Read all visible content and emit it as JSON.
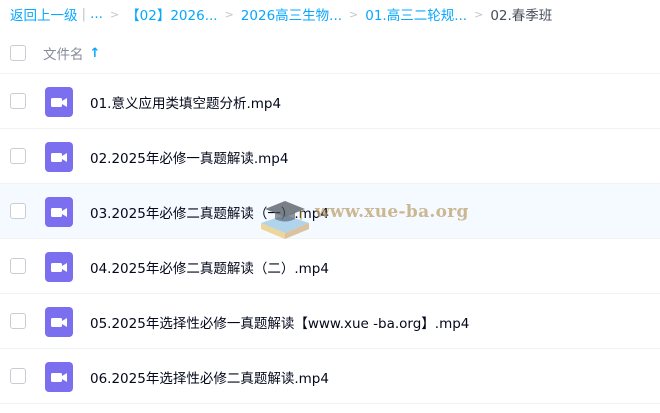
{
  "breadcrumb": {
    "back": "返回上一级",
    "ellipsis": "...",
    "items": [
      {
        "label": "【02】2026..."
      },
      {
        "label": "2026高三生物..."
      },
      {
        "label": "01.高三二轮规..."
      }
    ],
    "current": "02.春季班"
  },
  "header": {
    "name_label": "文件名",
    "sort_icon": "arrow-up-icon"
  },
  "files": [
    {
      "name": "01.意义应用类填空题分析.mp4",
      "icon": "video-file-icon"
    },
    {
      "name": "02.2025年必修一真题解读.mp4",
      "icon": "video-file-icon"
    },
    {
      "name": "03.2025年必修二真题解读（一）.mp4",
      "icon": "video-file-icon"
    },
    {
      "name": "04.2025年必修二真题解读（二）.mp4",
      "icon": "video-file-icon"
    },
    {
      "name": "05.2025年选择性必修一真题解读【www.xue -ba.org】.mp4",
      "icon": "video-file-icon"
    },
    {
      "name": "06.2025年选择性必修二真题解读.mp4",
      "icon": "video-file-icon"
    }
  ],
  "watermark": {
    "text": "www.xue-ba.org"
  },
  "colors": {
    "link": "#06a7ff",
    "video_icon": "#7b6ff0",
    "hover_row": "#f4faff"
  }
}
